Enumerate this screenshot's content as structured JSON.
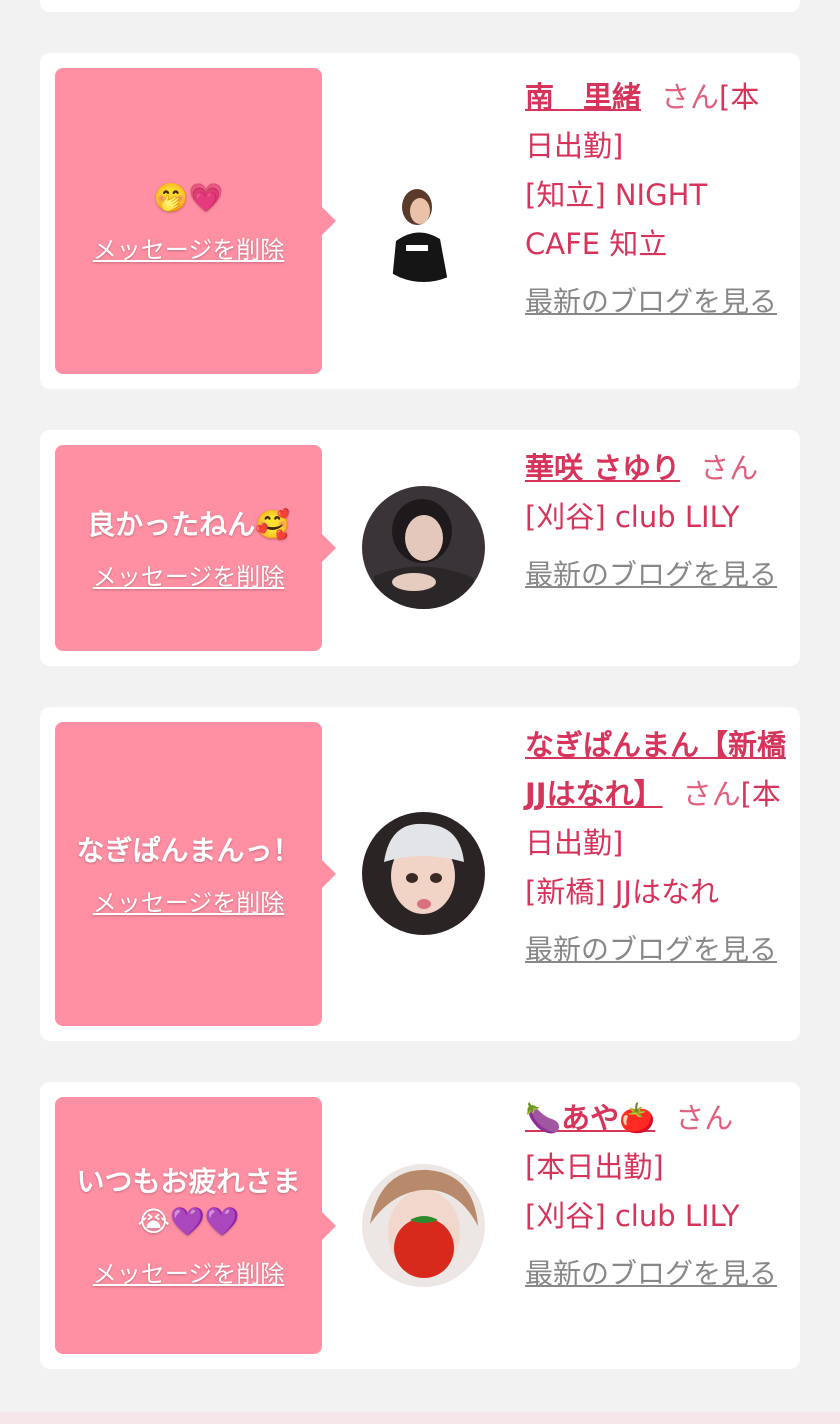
{
  "cards": [
    {
      "message": "🤭💗",
      "delete_label": "メッセージを削除",
      "name": "南　里緒",
      "san": "さん",
      "status": "[本日出勤]",
      "shop": "[知立] NIGHT CAFE 知立",
      "blog": "最新のブログを見る"
    },
    {
      "message": "良かったねん🥰",
      "delete_label": "メッセージを削除",
      "name": "華咲 さゆり",
      "san": "さん",
      "status": "",
      "shop": "[刈谷] club LILY",
      "blog": "最新のブログを見る"
    },
    {
      "message": "なぎぱんまんっ！",
      "delete_label": "メッセージを削除",
      "name": "なぎぱんまん【新橋JJはなれ】",
      "san": "さん",
      "status": "[本日出勤]",
      "shop": "[新橋] JJはなれ",
      "blog": "最新のブログを見る"
    },
    {
      "message": "いつもお疲れさま😭💜💜",
      "delete_label": "メッセージを削除",
      "name": "🍆あや🍅",
      "san": "さん",
      "status": "[本日出勤]",
      "shop": "[刈谷] club LILY",
      "blog": "最新のブログを見る"
    }
  ]
}
